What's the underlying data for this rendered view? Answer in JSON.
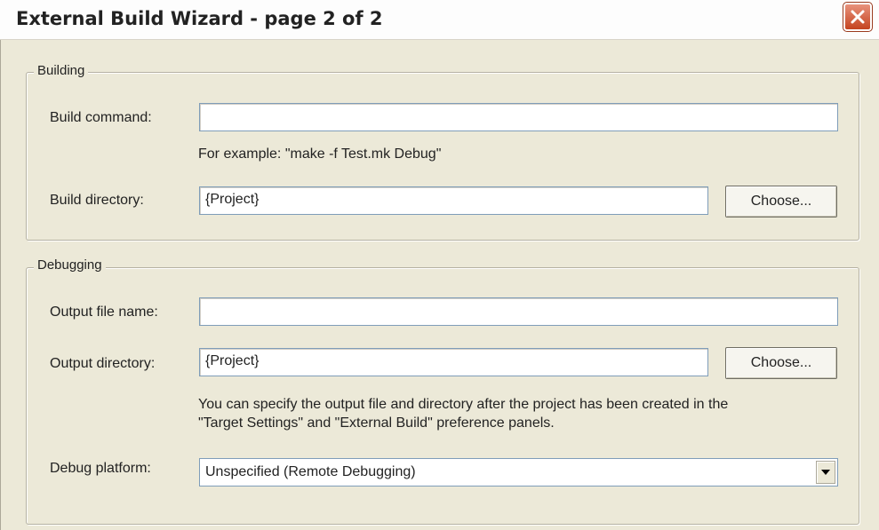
{
  "window": {
    "title": "External Build Wizard - page 2 of 2",
    "close_icon": "close-icon"
  },
  "building": {
    "legend": "Building",
    "build_command_label": "Build command:",
    "build_command_value": "",
    "example_hint": "For example: \"make -f Test.mk Debug\"",
    "build_directory_label": "Build directory:",
    "build_directory_value": "{Project}",
    "choose_label": "Choose..."
  },
  "debugging": {
    "legend": "Debugging",
    "output_file_label": "Output file name:",
    "output_file_value": "",
    "output_directory_label": "Output directory:",
    "output_directory_value": "{Project}",
    "choose_label": "Choose...",
    "hint_line1": "You can specify the output file and directory after the project has been created in the",
    "hint_line2": "\"Target Settings\" and \"External Build\" preference panels.",
    "debug_platform_label": "Debug platform:",
    "debug_platform_value": "Unspecified (Remote Debugging)",
    "dropdown_icon": "chevron-down-icon"
  },
  "colors": {
    "dialog_bg": "#ece9d8",
    "close_button": "#c4431f",
    "input_border": "#7f9db9"
  }
}
